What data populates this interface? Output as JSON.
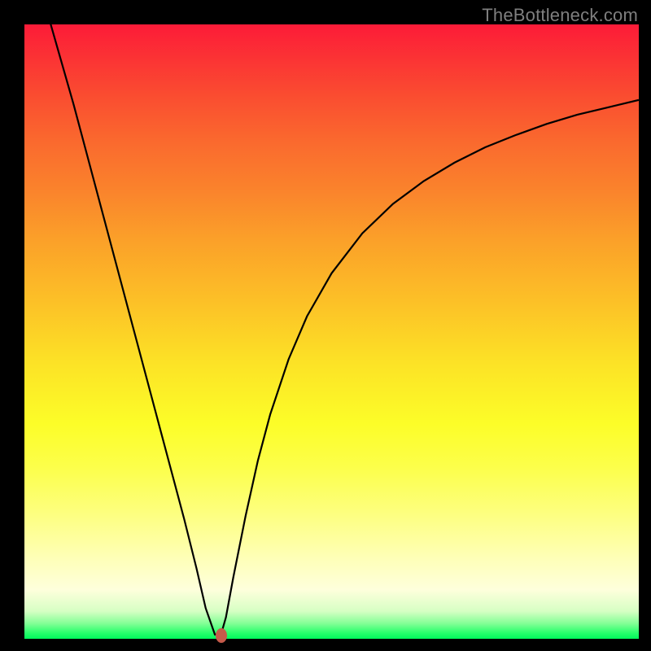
{
  "watermark": "TheBottleneck.com",
  "chart_data": {
    "type": "line",
    "title": "",
    "xlabel": "",
    "ylabel": "",
    "xlim": [
      0,
      100
    ],
    "ylim": [
      0,
      100
    ],
    "grid": false,
    "legend": false,
    "background": "gradient red-yellow-green (top→bottom)",
    "series": [
      {
        "name": "bottleneck-curve",
        "color": "#000000",
        "x": [
          4,
          6,
          8,
          10,
          12,
          14,
          16,
          18,
          20,
          22,
          24,
          26,
          28,
          29.5,
          31,
          32,
          32.8,
          34,
          36,
          38,
          40,
          43,
          46,
          50,
          55,
          60,
          65,
          70,
          75,
          80,
          85,
          90,
          95,
          100
        ],
        "y": [
          101,
          94,
          87,
          79.5,
          72,
          64.5,
          57,
          49.5,
          42,
          34.5,
          27,
          19.5,
          11.5,
          5,
          0.7,
          0.7,
          3.5,
          10,
          20,
          29,
          36.5,
          45.5,
          52.5,
          59.5,
          66,
          70.8,
          74.5,
          77.5,
          80,
          82,
          83.8,
          85.3,
          86.5,
          87.7
        ]
      }
    ],
    "annotations": [
      {
        "name": "optimum-point",
        "x": 32,
        "y": 0.5,
        "marker": "oval",
        "color": "#c55a4a"
      }
    ]
  },
  "colors": {
    "frame": "#000000",
    "gradient_top": "#fc1b38",
    "gradient_mid": "#fcfd28",
    "gradient_bottom": "#00f85b",
    "curve": "#000000",
    "dot": "#c55a4a",
    "watermark": "#7f7f7f"
  }
}
